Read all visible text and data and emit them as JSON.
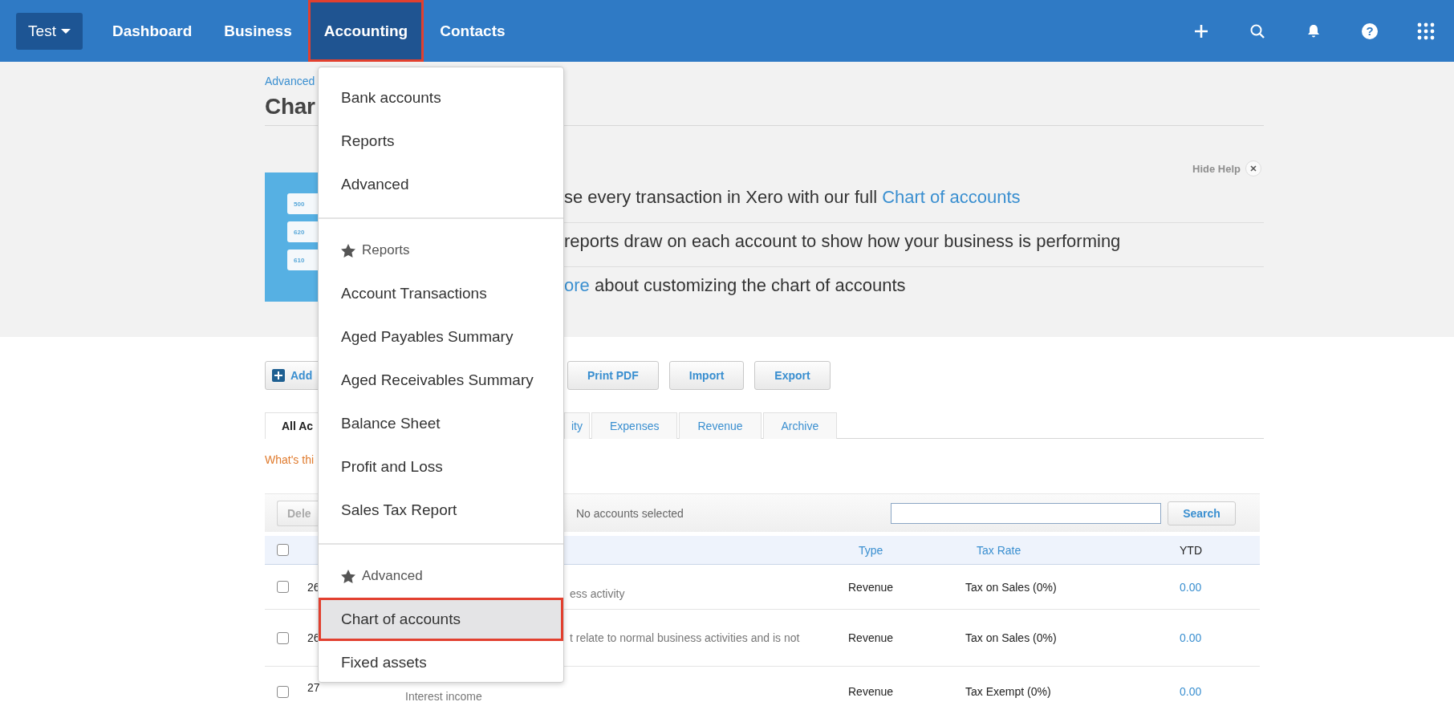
{
  "top_nav": {
    "org_button": {
      "label": "Test"
    },
    "items": [
      {
        "label": "Dashboard",
        "selected": false
      },
      {
        "label": "Business",
        "selected": false
      },
      {
        "label": "Accounting",
        "selected": true
      },
      {
        "label": "Contacts",
        "selected": false
      }
    ],
    "help_glyph": "?"
  },
  "header": {
    "breadcrumb": "Advanced",
    "title": "Char"
  },
  "help": {
    "hide_label": "Hide Help",
    "illustration_labels": [
      "500",
      "620",
      "610"
    ],
    "lines": [
      [
        {
          "kind": "plain",
          "text": "se every transaction in Xero with our full "
        },
        {
          "kind": "link",
          "text": "Chart of accounts"
        }
      ],
      [
        {
          "kind": "plain",
          "text": "reports draw on each account to show how your business is performing"
        }
      ],
      [
        {
          "kind": "link",
          "text": "ore"
        },
        {
          "kind": "plain",
          "text": " about customizing the chart of accounts"
        }
      ]
    ]
  },
  "actions": [
    {
      "label": "Add",
      "kind": "add"
    },
    {
      "label": "Print PDF",
      "kind": "plain"
    },
    {
      "label": "Import",
      "kind": "plain"
    },
    {
      "label": "Export",
      "kind": "plain"
    }
  ],
  "tabs": [
    {
      "label": "All Ac",
      "selected": true
    },
    {
      "label": "ity",
      "selected": false
    },
    {
      "label": "Expenses",
      "selected": false
    },
    {
      "label": "Revenue",
      "selected": false
    },
    {
      "label": "Archive",
      "selected": false
    }
  ],
  "whats_this": "What's thi",
  "table_toolbar": {
    "delete_button": "Dele",
    "selection_status": "No accounts selected",
    "search_button": "Search"
  },
  "table": {
    "select_all_checked": false,
    "columns": [
      {
        "label": "Type"
      },
      {
        "label": "Tax Rate"
      },
      {
        "label": "YTD"
      }
    ],
    "rows": [
      {
        "checked": false,
        "code": "26",
        "description": "ess activity",
        "type": "Revenue",
        "tax_rate": "Tax on Sales (0%)",
        "ytd": "0.00"
      },
      {
        "checked": false,
        "code": "26",
        "description": "t relate to normal business activities and is not",
        "type": "Revenue",
        "tax_rate": "Tax on Sales (0%)",
        "ytd": "0.00"
      },
      {
        "checked": false,
        "code": "27",
        "description": "Interest income",
        "type": "Revenue",
        "tax_rate": "Tax Exempt (0%)",
        "ytd": "0.00"
      }
    ]
  },
  "menu": {
    "sections": [
      {
        "items": [
          {
            "label": "Bank accounts",
            "selected": false
          },
          {
            "label": "Reports",
            "selected": false
          },
          {
            "label": "Advanced",
            "selected": false
          }
        ]
      },
      {
        "heading": "Reports",
        "items": [
          {
            "label": "Account Transactions",
            "selected": false
          },
          {
            "label": "Aged Payables Summary",
            "selected": false
          },
          {
            "label": "Aged Receivables Summary",
            "selected": false
          },
          {
            "label": "Balance Sheet",
            "selected": false
          },
          {
            "label": "Profit and Loss",
            "selected": false
          },
          {
            "label": "Sales Tax Report",
            "selected": false
          }
        ]
      },
      {
        "heading": "Advanced",
        "items": [
          {
            "label": "Chart of accounts",
            "selected": true
          },
          {
            "label": "Fixed assets",
            "selected": false
          }
        ]
      }
    ]
  }
}
